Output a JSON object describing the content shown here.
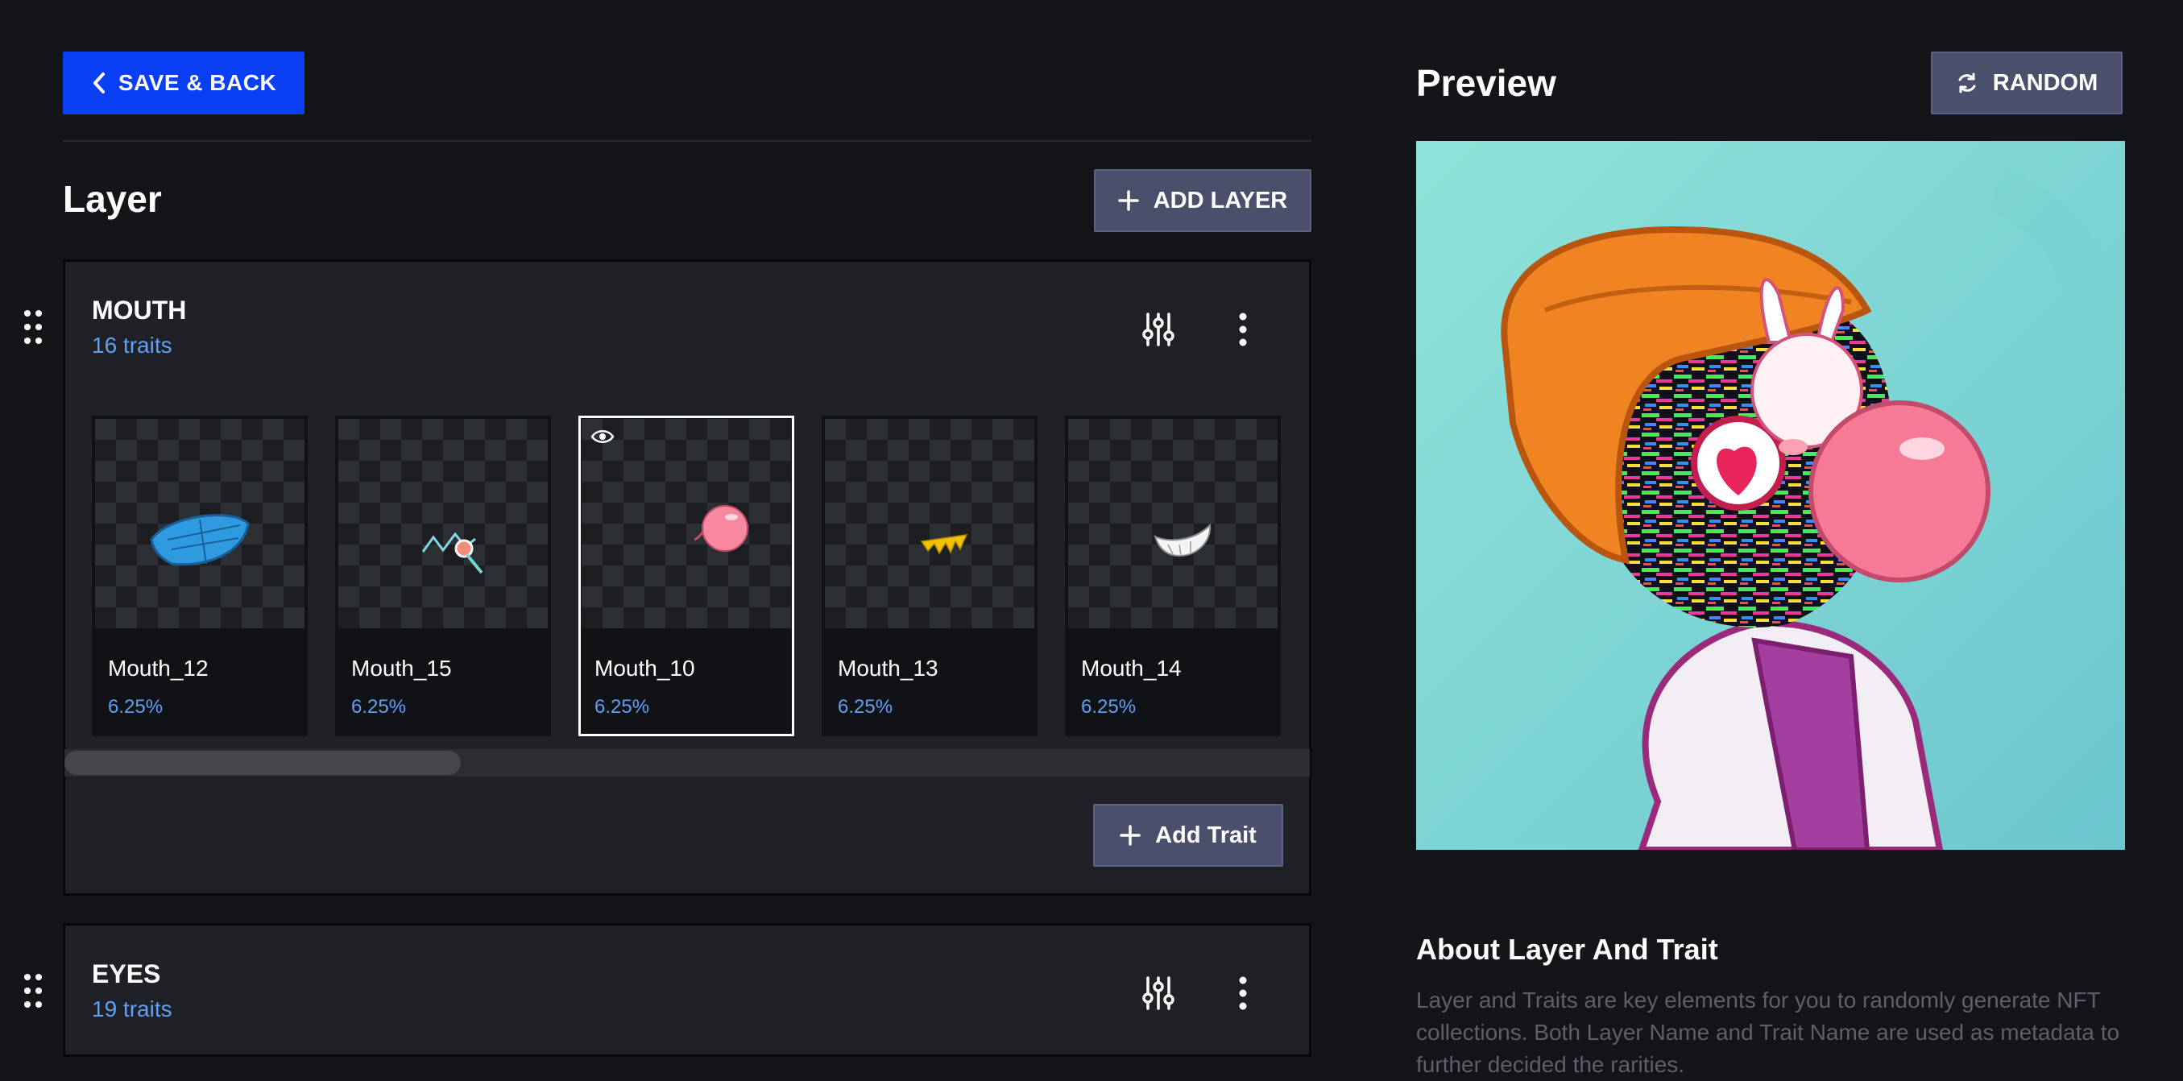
{
  "toolbar": {
    "save_back_label": "SAVE & BACK"
  },
  "layer_section": {
    "title": "Layer",
    "add_layer_label": "ADD LAYER"
  },
  "layers": [
    {
      "name": "MOUTH",
      "count": "16 traits",
      "add_trait_label": "Add Trait",
      "traits": [
        {
          "name": "Mouth_12",
          "pct": "6.25%",
          "icon": "blue-mask-icon"
        },
        {
          "name": "Mouth_15",
          "pct": "6.25%",
          "icon": "lollipop-mouth-icon"
        },
        {
          "name": "Mouth_10",
          "pct": "6.25%",
          "icon": "bubblegum-icon",
          "selected": true
        },
        {
          "name": "Mouth_13",
          "pct": "6.25%",
          "icon": "yellow-teeth-icon"
        },
        {
          "name": "Mouth_14",
          "pct": "6.25%",
          "icon": "white-grin-icon"
        }
      ]
    },
    {
      "name": "EYES",
      "count": "19 traits"
    }
  ],
  "preview": {
    "title": "Preview",
    "random_label": "RANDOM"
  },
  "about": {
    "title": "About Layer And Trait",
    "text": "Layer and Traits are key elements for you to randomly generate NFT collections. Both Layer Name and Trait Name are used as metadata to further decided the rarities."
  },
  "colors": {
    "accent": "#0a3ff5",
    "link": "#5ea0f5",
    "secondary_button": "#4a4f6b",
    "background": "#131519"
  }
}
